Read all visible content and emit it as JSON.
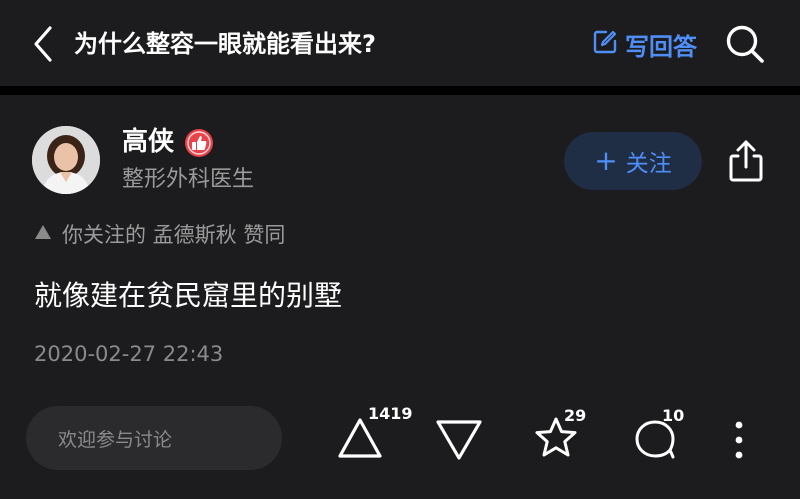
{
  "header": {
    "back_icon": "chevron-left-icon",
    "question_title": "为什么整容一眼就能看出来?",
    "write_answer_label": "写回答",
    "write_answer_icon": "edit-icon",
    "search_icon": "search-icon"
  },
  "author": {
    "name": "高侠",
    "badge_icon": "thumb-up-badge-icon",
    "bio": "整形外科医生",
    "follow_label": "关注",
    "share_icon": "share-icon"
  },
  "endorsement": {
    "icon": "triangle-up-icon",
    "text": "你关注的 孟德斯秋 赞同"
  },
  "answer": {
    "body": "就像建在贫民窟里的别墅",
    "timestamp": "2020-02-27 22:43"
  },
  "bottom_bar": {
    "comment_placeholder": "欢迎参与讨论",
    "upvote_count": "1419",
    "favorite_count": "29",
    "comment_count": "10"
  },
  "colors": {
    "background": "#1c1c1e",
    "accent": "#4f8ef7",
    "badge": "#e8424a"
  }
}
